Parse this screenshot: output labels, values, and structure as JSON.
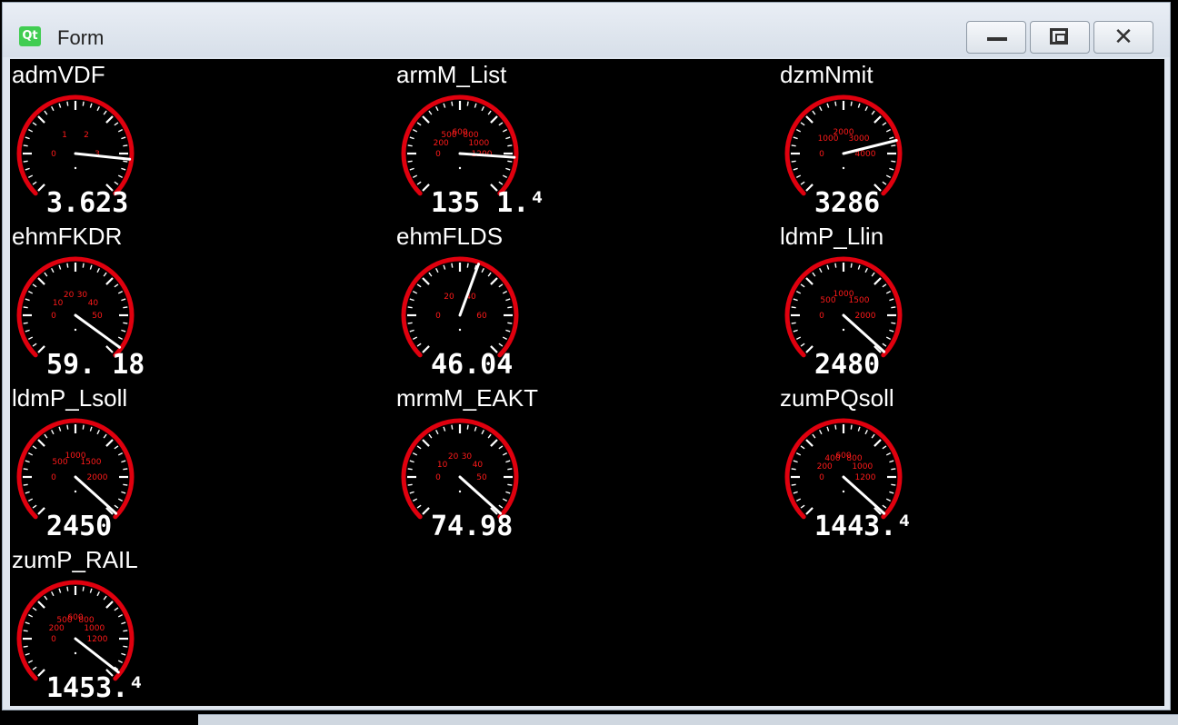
{
  "window": {
    "title": "Form",
    "logo_text": "Qt",
    "minimize_icon": "minimize-icon",
    "maximize_icon": "maximize-icon",
    "close_icon": "close-icon",
    "close_glyph": "✕"
  },
  "colors": {
    "background": "#000000",
    "gauge_ring": "#e0000e",
    "scale_text": "#ff1a1a",
    "needle": "#ffffff"
  },
  "gauges": [
    {
      "label": "admVDF",
      "value": "3.623",
      "scale": [
        "0",
        "1",
        "2",
        "3"
      ]
    },
    {
      "label": "armM_List",
      "value": "135 1.⁴",
      "scale": [
        "0",
        "200",
        "500",
        "600",
        "800",
        "1000",
        "1200"
      ]
    },
    {
      "label": "dzmNmit",
      "value": "3286",
      "scale": [
        "0",
        "1000",
        "2000",
        "3000",
        "4000"
      ]
    },
    {
      "label": "ehmFKDR",
      "value": "59. 18",
      "scale": [
        "0",
        "10",
        "20",
        "30",
        "40",
        "50"
      ]
    },
    {
      "label": "ehmFLDS",
      "value": "46.04",
      "scale": [
        "0",
        "20",
        "40",
        "60"
      ]
    },
    {
      "label": "ldmP_Llin",
      "value": "2480",
      "scale": [
        "0",
        "500",
        "1000",
        "1500",
        "2000"
      ]
    },
    {
      "label": "ldmP_Lsoll",
      "value": "2450",
      "scale": [
        "0",
        "500",
        "1000",
        "1500",
        "2000"
      ]
    },
    {
      "label": "mrmM_EAKT",
      "value": "74.98",
      "scale": [
        "0",
        "10",
        "20",
        "30",
        "40",
        "50"
      ]
    },
    {
      "label": "zumPQsoll",
      "value": "1443.⁴",
      "scale": [
        "0",
        "200",
        "400",
        "600",
        "800",
        "1000",
        "1200"
      ]
    },
    {
      "label": "zumP_RAIL",
      "value": "1453.⁴",
      "scale": [
        "0",
        "200",
        "500",
        "600",
        "800",
        "1000",
        "1200"
      ]
    }
  ]
}
